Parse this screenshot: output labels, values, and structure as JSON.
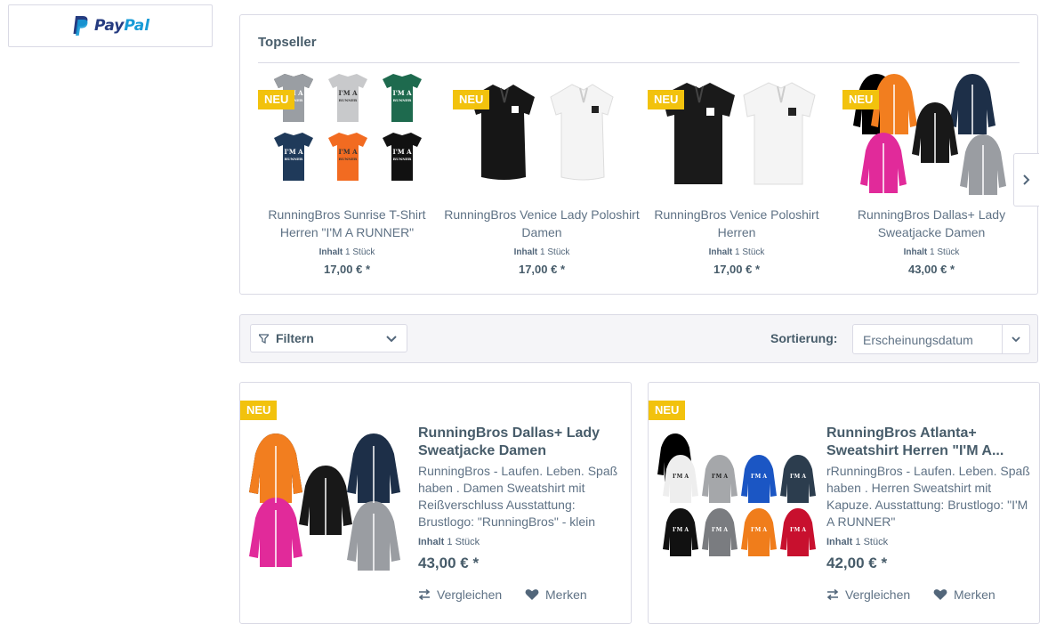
{
  "paypal": {
    "pay": "Pay",
    "pal": "Pal"
  },
  "topseller": {
    "title": "Topseller",
    "items": [
      {
        "badge": "NEU",
        "name": "RunningBros Sunrise T-Shirt Herren \"I'M A RUNNER\"",
        "unit_label": "Inhalt",
        "unit_value": "1 Stück",
        "price": "17,00 € *"
      },
      {
        "badge": "NEU",
        "name": "RunningBros Venice Lady Poloshirt Damen",
        "unit_label": "Inhalt",
        "unit_value": "1 Stück",
        "price": "17,00 € *"
      },
      {
        "badge": "NEU",
        "name": "RunningBros Venice Poloshirt Herren",
        "unit_label": "Inhalt",
        "unit_value": "1 Stück",
        "price": "17,00 € *"
      },
      {
        "badge": "NEU",
        "name": "RunningBros Dallas+ Lady Sweatjacke Damen",
        "unit_label": "Inhalt",
        "unit_value": "1 Stück",
        "price": "43,00 € *"
      }
    ]
  },
  "filter": {
    "label": "Filtern"
  },
  "sort": {
    "label": "Sortierung:",
    "value": "Erscheinungsdatum"
  },
  "products": [
    {
      "badge": "NEU",
      "title": "RunningBros Dallas+ Lady Sweatjacke Damen",
      "desc": "RunningBros - Laufen. Leben. Spaß haben . Damen Sweatshirt mit Reißverschluss Ausstattung: Brustlogo: \"RunningBros\" - klein",
      "unit_label": "Inhalt",
      "unit_value": "1 Stück",
      "price": "43,00 € *",
      "compare": "Vergleichen",
      "remember": "Merken"
    },
    {
      "badge": "NEU",
      "title": "RunningBros Atlanta+ Sweatshirt Herren \"I'M A...",
      "desc": "rRunningBros - Laufen. Leben. Spaß haben . Herren Sweatshirt mit Kapuze. Ausstattung: Brustlogo: \"I'M A RUNNER\"",
      "unit_label": "Inhalt",
      "unit_value": "1 Stück",
      "price": "42,00 € *",
      "compare": "Vergleichen",
      "remember": "Merken"
    }
  ],
  "colors": {
    "badge": "#f2c20d",
    "border": "#dadae5",
    "text": "#475c6a"
  },
  "icons": [
    "paypal-icon",
    "chevron-right-icon",
    "filter-icon",
    "chevron-down-icon",
    "compare-icon",
    "heart-icon"
  ]
}
